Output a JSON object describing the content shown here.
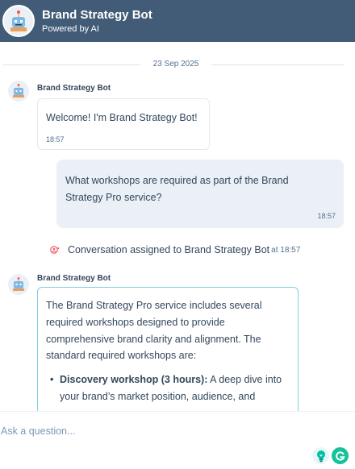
{
  "header": {
    "title": "Brand Strategy Bot",
    "subtitle": "Powered by AI",
    "bg_color": "#425b76"
  },
  "conversation": {
    "date": "23 Sep 2025",
    "messages": [
      {
        "type": "bot",
        "sender": "Brand Strategy Bot",
        "text": "Welcome! I'm Brand Strategy Bot!",
        "time": "18:57"
      },
      {
        "type": "user",
        "text_line1": "What workshops are required as part of the Brand",
        "text_line2": "Strategy Pro service?",
        "time": "18:57"
      },
      {
        "type": "system",
        "text": "Conversation assigned to Brand Strategy Bot",
        "time": "at 18:57"
      },
      {
        "type": "bot",
        "sender": "Brand Strategy Bot",
        "paragraph_lines": [
          "The Brand Strategy Pro service includes several",
          "required workshops designed to provide",
          "comprehensive brand clarity and alignment. The",
          "standard required workshops are:"
        ],
        "bullets": [
          {
            "title": "Discovery workshop (3 hours):",
            "line1_rest": " A deep dive into",
            "line2": "your brand’s market position, audience, and"
          }
        ]
      }
    ]
  },
  "composer": {
    "placeholder": "Ask a question...",
    "tools": [
      {
        "name": "lightbulb-icon",
        "color": "#00bda5"
      },
      {
        "name": "grammarly-icon",
        "color": "#15c39a"
      }
    ]
  },
  "colors": {
    "bot_bubble_highlight_border": "#7fd1de",
    "user_bubble_bg": "#eaf0f6",
    "system_icon": "#f2545b"
  }
}
